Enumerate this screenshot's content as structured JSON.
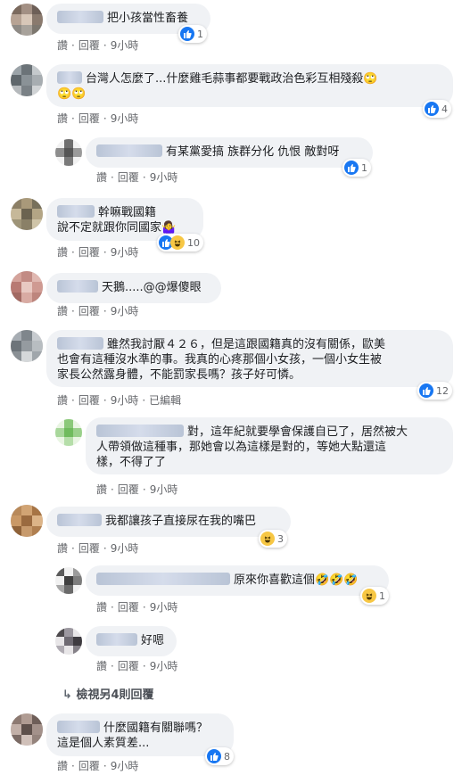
{
  "labels": {
    "like": "讚",
    "reply": "回覆",
    "edited": "已編輯"
  },
  "comments": [
    {
      "text": "把小孩當性畜養",
      "time": "9小時",
      "reactions": "1"
    },
    {
      "text1": "台灣人怎麼了...什麼雞毛蒜事都要戰政治色彩互相殘殺",
      "time": "9小時",
      "reactions": "4"
    },
    {
      "text": "有某黨愛搞 族群分化 仇恨 敵對呀",
      "time": "9小時",
      "reactions": "1"
    },
    {
      "text1": "幹嘛戰國籍",
      "text2": "說不定就跟你同國家",
      "time": "9小時",
      "reactions": "10"
    },
    {
      "text": "天鵝.....@@爆傻眼",
      "time": "9小時"
    },
    {
      "text1": "雖然我討厭４２６，但是這跟國籍真的沒有關係，歐美",
      "text2": "也會有這種沒水準的事。我真的心疼那個小女孩，一個小女生被",
      "text3": "家長公然露身體，不能罰家長嗎？孩子好可憐。",
      "time": "9小時",
      "reactions": "12"
    },
    {
      "text1": "對，這年紀就要學會保護自已了，居然被大",
      "text2": "人帶領做這種事，那她會以為這樣是對的，等她大點還這",
      "text3": "樣，不得了了",
      "time": "9小時"
    },
    {
      "text": "我都讓孩子直接尿在我的嘴巴",
      "time": "9小時",
      "reactions": "3"
    },
    {
      "text": "原來你喜歡這個",
      "time": "9小時",
      "reactions": "1"
    },
    {
      "text": "好嗯",
      "time": "9小時"
    },
    {
      "text1": "什麼國籍有關聯嗎？",
      "text2": "這是個人素質差...",
      "time": "9小時",
      "reactions": "8"
    }
  ],
  "view_more": "檢視另4則回覆"
}
